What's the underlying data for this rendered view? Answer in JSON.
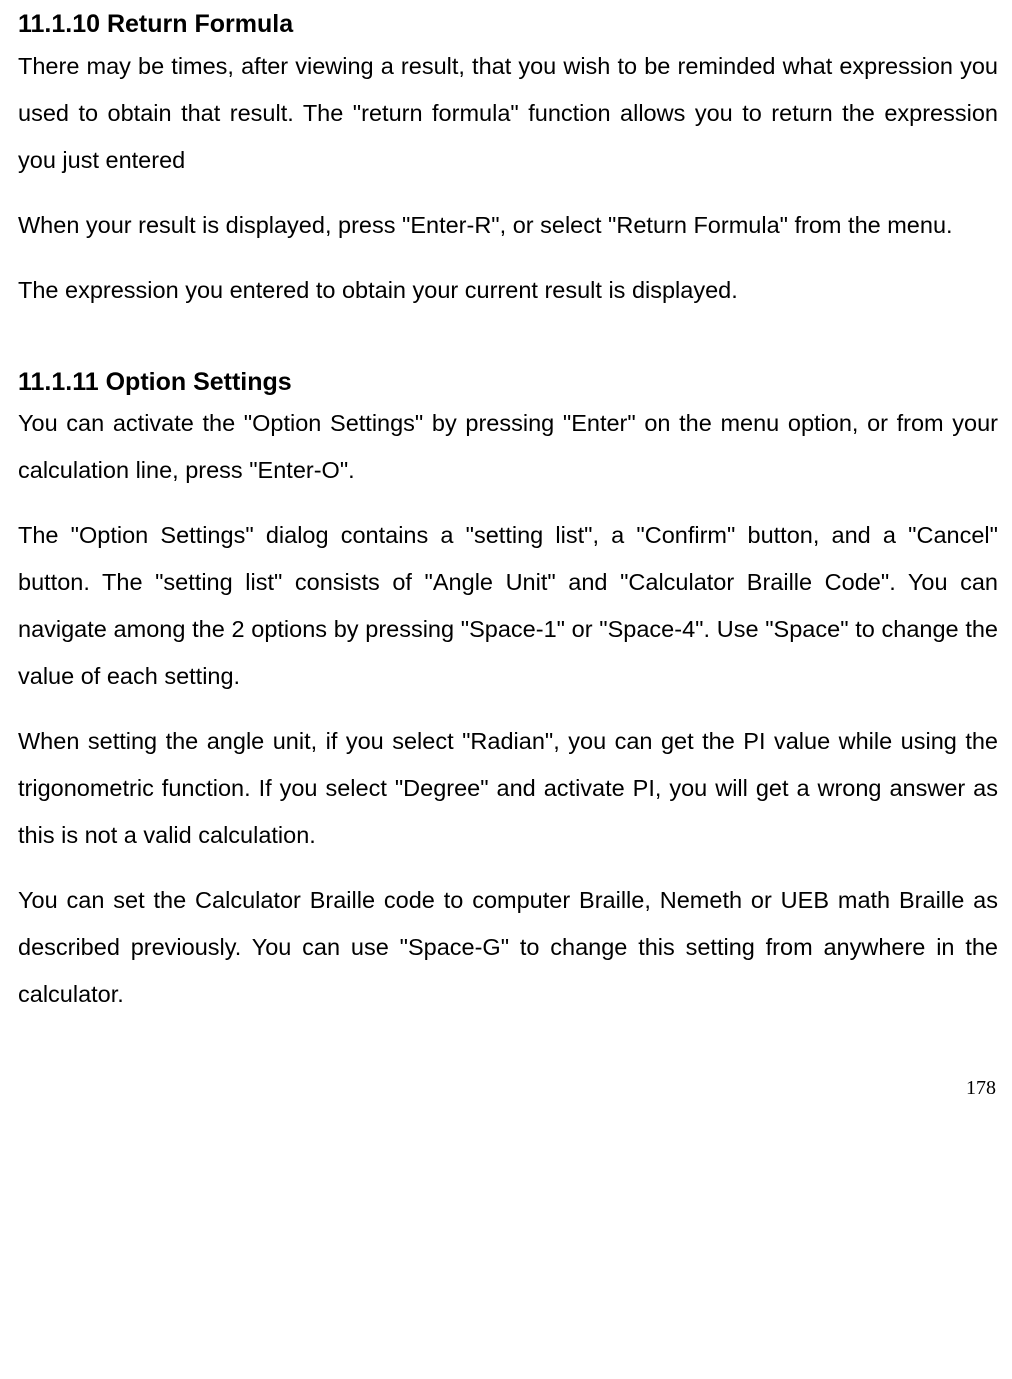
{
  "section1": {
    "heading": "11.1.10 Return Formula",
    "p1": "There may be times, after viewing a result, that you wish to be reminded what expression you used to obtain that result. The \"return formula\" function allows you to return the expression you just entered",
    "p2": "When your result is displayed, press \"Enter-R\", or select \"Return Formula\" from the menu.",
    "p3": "The expression you entered to obtain your current result is displayed."
  },
  "section2": {
    "heading": "11.1.11 Option Settings",
    "p1": "You can activate the \"Option Settings\" by pressing \"Enter\" on the menu option, or from your calculation line, press \"Enter-O\".",
    "p2": "The \"Option Settings\" dialog contains a \"setting list\", a \"Confirm\" button, and a \"Cancel\" button. The \"setting list\" consists of \"Angle Unit\" and \"Calculator Braille Code\". You can navigate among the 2 options by pressing \"Space-1\" or \"Space-4\". Use \"Space\" to change the value of each setting.",
    "p3": "When setting the angle unit, if you select \"Radian\", you can get the PI value while using the trigonometric function. If you select \"Degree\" and activate PI, you will get a wrong answer as this is not a valid calculation.",
    "p4": "You can set the Calculator Braille code to computer Braille, Nemeth or UEB math Braille as described previously. You can use \"Space-G\" to change this setting from anywhere in the calculator."
  },
  "pageNumber": "178"
}
